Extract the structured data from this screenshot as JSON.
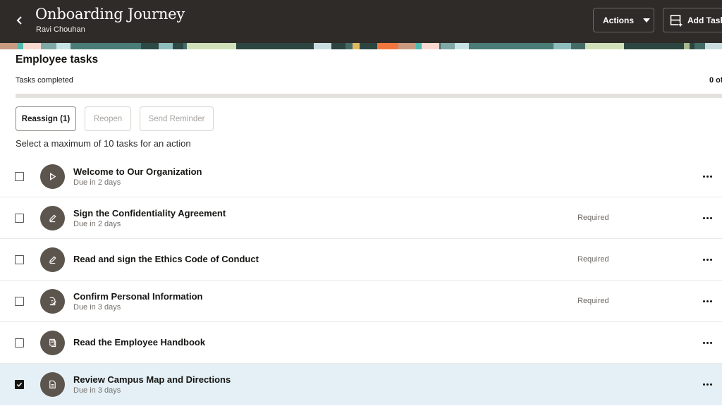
{
  "header": {
    "title": "Onboarding Journey",
    "subtitle": "Ravi Chouhan",
    "back_icon": "chevron-left-icon",
    "actions_label": "Actions",
    "add_tasks_label": "Add Tasks",
    "background_color": "#2f2b28"
  },
  "section": {
    "title": "Employee tasks",
    "progress_label": "Tasks completed",
    "progress_count": "0 of",
    "progress_fraction": 0
  },
  "toolbar": {
    "reassign_label": "Reassign (1)",
    "reopen_label": "Reopen",
    "send_reminder_label": "Send Reminder",
    "hint": "Select a maximum of 10 tasks for an action"
  },
  "tasks": [
    {
      "title": "Welcome to Our Organization",
      "due": "Due in 2 days",
      "required": "",
      "icon": "play-icon",
      "checked": false
    },
    {
      "title": "Sign the Confidentiality Agreement",
      "due": "Due in 2 days",
      "required": "Required",
      "icon": "pencil-icon",
      "checked": false
    },
    {
      "title": "Read and sign the Ethics Code of Conduct",
      "due": "",
      "required": "Required",
      "icon": "pencil-icon",
      "checked": false
    },
    {
      "title": "Confirm Personal Information",
      "due": "Due in 3 days",
      "required": "Required",
      "icon": "document-edit-icon",
      "checked": false
    },
    {
      "title": "Read the Employee Handbook",
      "due": "",
      "required": "",
      "icon": "documents-icon",
      "checked": false
    },
    {
      "title": "Review Campus Map and Directions",
      "due": "Due in 3 days",
      "required": "",
      "icon": "document-icon",
      "checked": true
    }
  ],
  "colors": {
    "selected_row": "#e4f0f6",
    "icon_circle": "#5c554e"
  }
}
